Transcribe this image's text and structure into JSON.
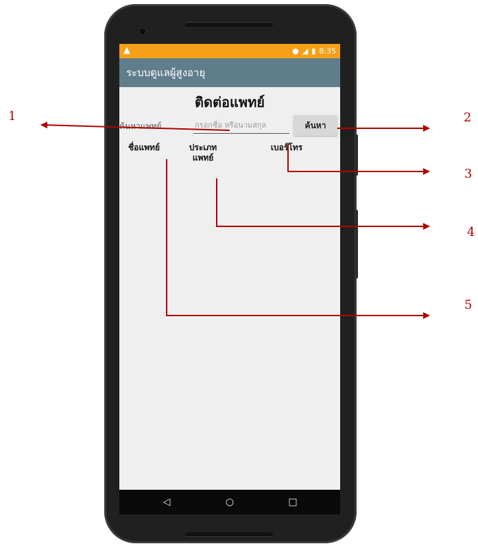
{
  "status_bar": {
    "warning_icon": "warning-icon",
    "time": "8:35"
  },
  "app_bar": {
    "title": "ระบบดูแลผู้สูงอายุ"
  },
  "page": {
    "title": "ติดต่อแพทย์"
  },
  "search": {
    "label": "ค้นหาแพทย์",
    "placeholder": "กรอกชื่อ หรือนามสกุล",
    "value": "",
    "button_label": "ค้นหา"
  },
  "columns": {
    "name": "ชื่อแพทย์",
    "type_line1": "ประเภท",
    "type_line2": "แพทย์",
    "phone": "เบอร์โทร"
  },
  "nav": {
    "back": "◁",
    "home": "○",
    "recent": "□"
  },
  "annotations": [
    "1",
    "2",
    "3",
    "4",
    "5"
  ],
  "colors": {
    "status_bar": "#f6a01a",
    "app_bar": "#607d8b",
    "annotation": "#b00000"
  }
}
